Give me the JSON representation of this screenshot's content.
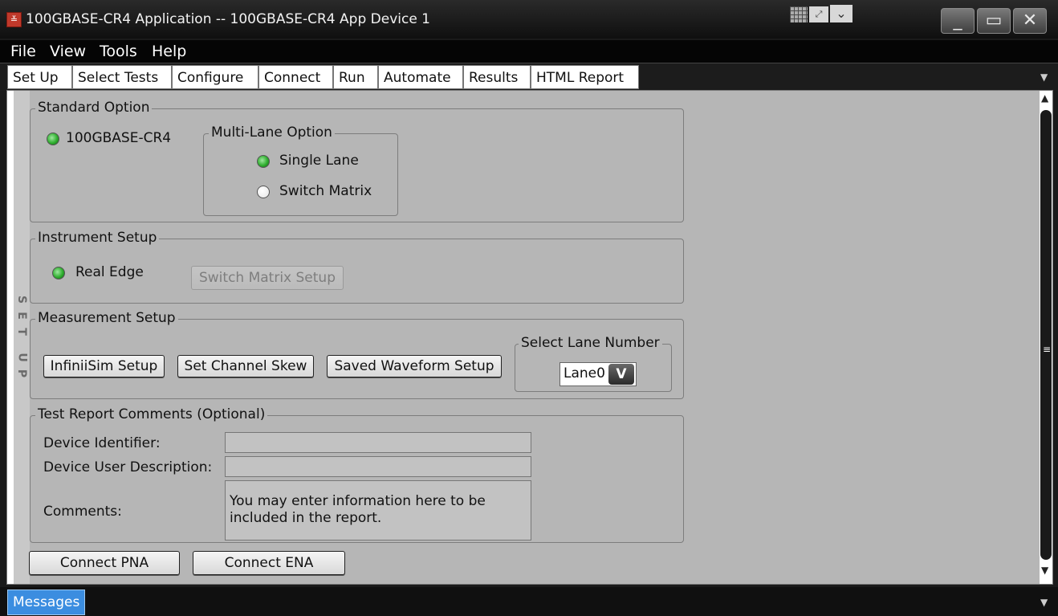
{
  "window": {
    "title": "100GBASE-CR4 Application -- 100GBASE-CR4 App Device 1",
    "icon": "app-icon",
    "controls": [
      "minimize-icon",
      "maximize-icon",
      "close-icon"
    ]
  },
  "menu": {
    "items": [
      "File",
      "View",
      "Tools",
      "Help"
    ]
  },
  "tabs": {
    "items": [
      "Set Up",
      "Select Tests",
      "Configure",
      "Connect",
      "Run",
      "Automate",
      "Results",
      "HTML Report"
    ],
    "selected": "Set Up"
  },
  "side_label": "SET UP",
  "standard_option": {
    "legend": "Standard Option",
    "radio_label": "100GBASE-CR4",
    "multi_lane": {
      "legend": "Multi-Lane Option",
      "options": [
        "Single Lane",
        "Switch Matrix"
      ],
      "selected": "Single Lane"
    }
  },
  "instrument_setup": {
    "legend": "Instrument Setup",
    "radio_label": "Real Edge",
    "switch_matrix_button": "Switch Matrix Setup"
  },
  "measurement_setup": {
    "legend": "Measurement Setup",
    "buttons": [
      "InfiniiSim Setup",
      "Set Channel Skew",
      "Saved Waveform Setup"
    ],
    "lane": {
      "legend": "Select Lane Number",
      "value": "Lane0",
      "icon": "chevron-down-icon"
    }
  },
  "report_comments": {
    "legend": "Test Report Comments (Optional)",
    "device_identifier_label": "Device Identifier:",
    "device_identifier_value": "",
    "device_description_label": "Device User Description:",
    "device_description_value": "",
    "comments_label": "Comments:",
    "comments_value": "You may enter information here to be included in the report."
  },
  "bottom_buttons": [
    "Connect PNA",
    "Connect ENA"
  ],
  "messages_tab": "Messages",
  "colors": {
    "radio_on": "#2fae2f",
    "panel": "#b6b6b6",
    "messages_tab": "#3b8de0"
  }
}
